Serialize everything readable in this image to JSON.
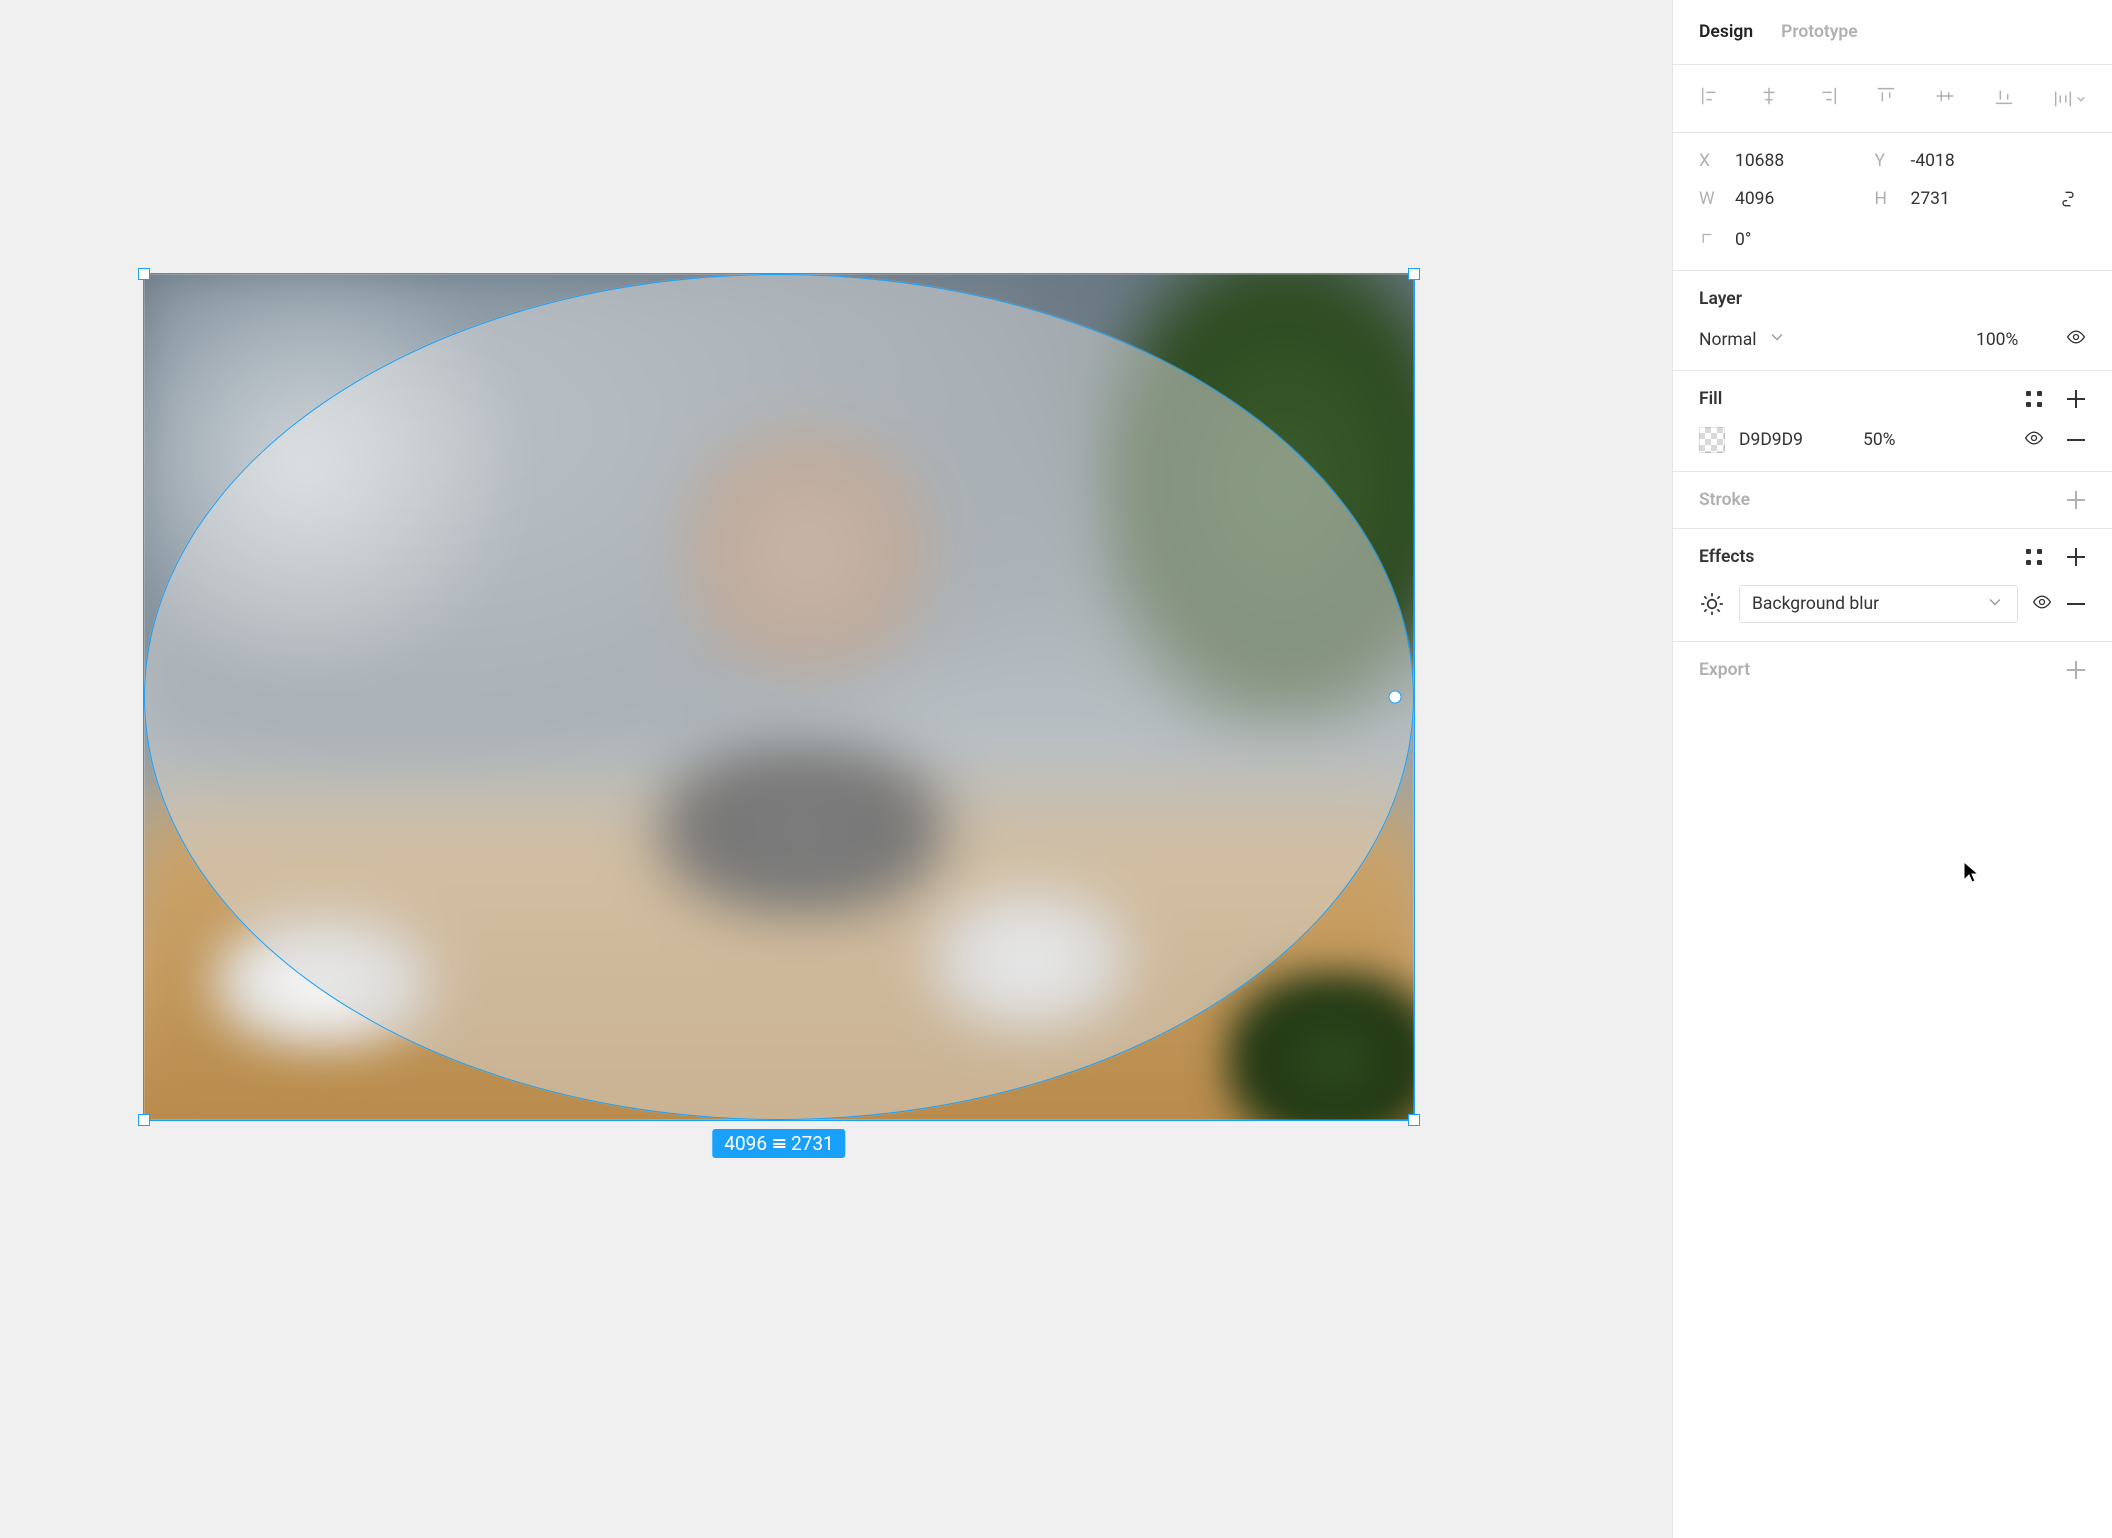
{
  "tabs": {
    "design": "Design",
    "prototype": "Prototype"
  },
  "transform": {
    "x_label": "X",
    "x": "10688",
    "y_label": "Y",
    "y": "-4018",
    "w_label": "W",
    "w": "4096",
    "h_label": "H",
    "h": "2731",
    "rotation": "0°"
  },
  "selection_badge": {
    "w": "4096",
    "h": "2731"
  },
  "layer": {
    "title": "Layer",
    "blend_mode": "Normal",
    "opacity": "100%"
  },
  "fill": {
    "title": "Fill",
    "hex": "D9D9D9",
    "opacity": "50%"
  },
  "stroke": {
    "title": "Stroke"
  },
  "effects": {
    "title": "Effects",
    "items": [
      {
        "type": "Background blur"
      }
    ]
  },
  "export": {
    "title": "Export"
  }
}
